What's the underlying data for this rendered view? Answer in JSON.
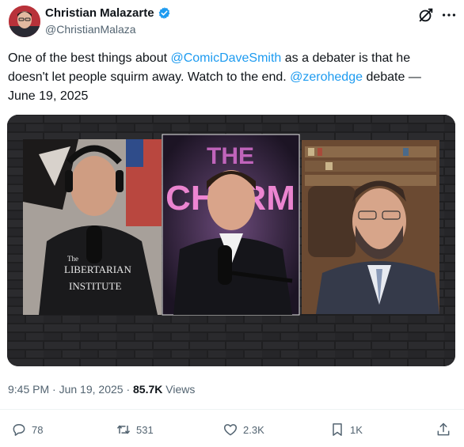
{
  "author": {
    "name": "Christian Malazarte",
    "handle": "@ChristianMalaza"
  },
  "tweet": {
    "text_before_mention1": "One of the best things about ",
    "mention1": "@ComicDaveSmith",
    "text_middle": " as a debater is that he doesn't let people squirm away. Watch to the end. ",
    "mention2": "@zerohedge",
    "text_after": " debate — June 19, 2025"
  },
  "media": {
    "sign_top": "THE",
    "sign_bottom": "CHARM",
    "hoodie_top": "The",
    "hoodie_mid": "LIBERTARIAN",
    "hoodie_bottom": "INSTITUTE"
  },
  "meta": {
    "time": "9:45 PM",
    "sep1": " · ",
    "date": "Jun 19, 2025",
    "sep2": " · ",
    "views_count": "85.7K",
    "views_label": " Views"
  },
  "actions": {
    "replies": "78",
    "reposts": "531",
    "likes": "2.3K",
    "bookmarks": "1K"
  },
  "colors": {
    "accent": "#1d9bf0",
    "text": "#0f1419",
    "secondary": "#536471"
  }
}
